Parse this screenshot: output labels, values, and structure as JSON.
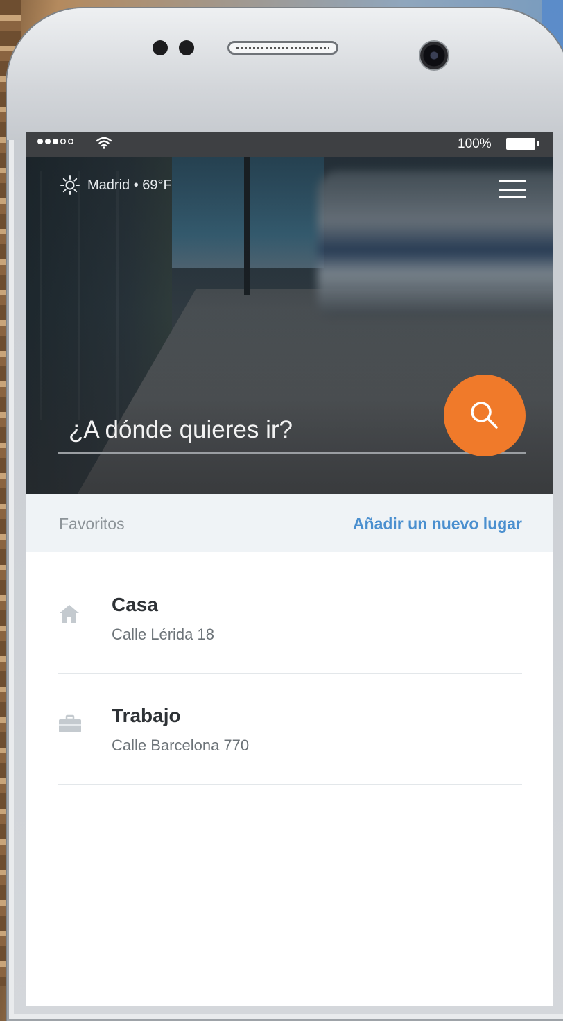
{
  "status_bar": {
    "battery_percent": "100%",
    "signal_bars_filled": 3,
    "signal_bars_total": 5,
    "battery_level": 1.0
  },
  "header": {
    "weather": "Madrid • 69°F",
    "weather_icon": "sun-icon",
    "menu_icon": "hamburger-menu-icon"
  },
  "search": {
    "placeholder": "¿A dónde quieres ir?",
    "value": "",
    "button_icon": "search-icon"
  },
  "favorites": {
    "title": "Favoritos",
    "add_link": "Añadir un nuevo lugar",
    "items": [
      {
        "name": "Casa",
        "address": "Calle Lérida 18",
        "icon": "home-icon"
      },
      {
        "name": "Trabajo",
        "address": "Calle Barcelona 770",
        "icon": "briefcase-icon"
      }
    ]
  },
  "colors": {
    "accent": "#f07a2a",
    "link": "#4a8fcf",
    "header_bg": "#eff3f6",
    "status_bar_bg": "#3e4043"
  }
}
